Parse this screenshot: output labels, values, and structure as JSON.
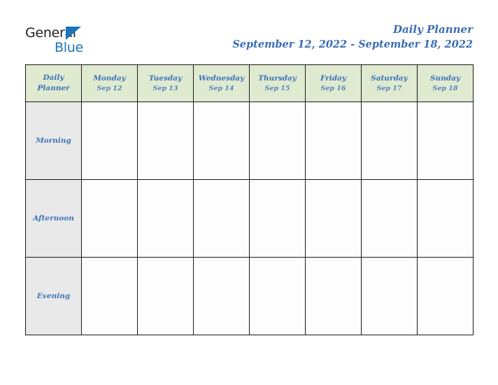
{
  "brand": {
    "name_part1": "General",
    "name_part2": "Blue",
    "triangle_icon": "triangle-logo-icon",
    "accent_color": "#1b75bb"
  },
  "header": {
    "title": "Daily Planner",
    "date_range": "September 12, 2022 - September 18, 2022",
    "title_color": "#3a6cb4"
  },
  "grid": {
    "corner": {
      "line1": "Daily",
      "line2": "Planner"
    },
    "header_bg": "#dfead0",
    "label_bg": "#e9e9e9",
    "border_color": "#1a1a1a",
    "columns": [
      {
        "day": "Monday",
        "date": "Sep 12"
      },
      {
        "day": "Tuesday",
        "date": "Sep 13"
      },
      {
        "day": "Wednesday",
        "date": "Sep 14"
      },
      {
        "day": "Thursday",
        "date": "Sep 15"
      },
      {
        "day": "Friday",
        "date": "Sep 16"
      },
      {
        "day": "Saturday",
        "date": "Sep 17"
      },
      {
        "day": "Sunday",
        "date": "Sep 18"
      }
    ],
    "rows": [
      {
        "label": "Morning",
        "cells": [
          "",
          "",
          "",
          "",
          "",
          "",
          ""
        ]
      },
      {
        "label": "Afternoon",
        "cells": [
          "",
          "",
          "",
          "",
          "",
          "",
          ""
        ]
      },
      {
        "label": "Evening",
        "cells": [
          "",
          "",
          "",
          "",
          "",
          "",
          ""
        ]
      }
    ]
  }
}
